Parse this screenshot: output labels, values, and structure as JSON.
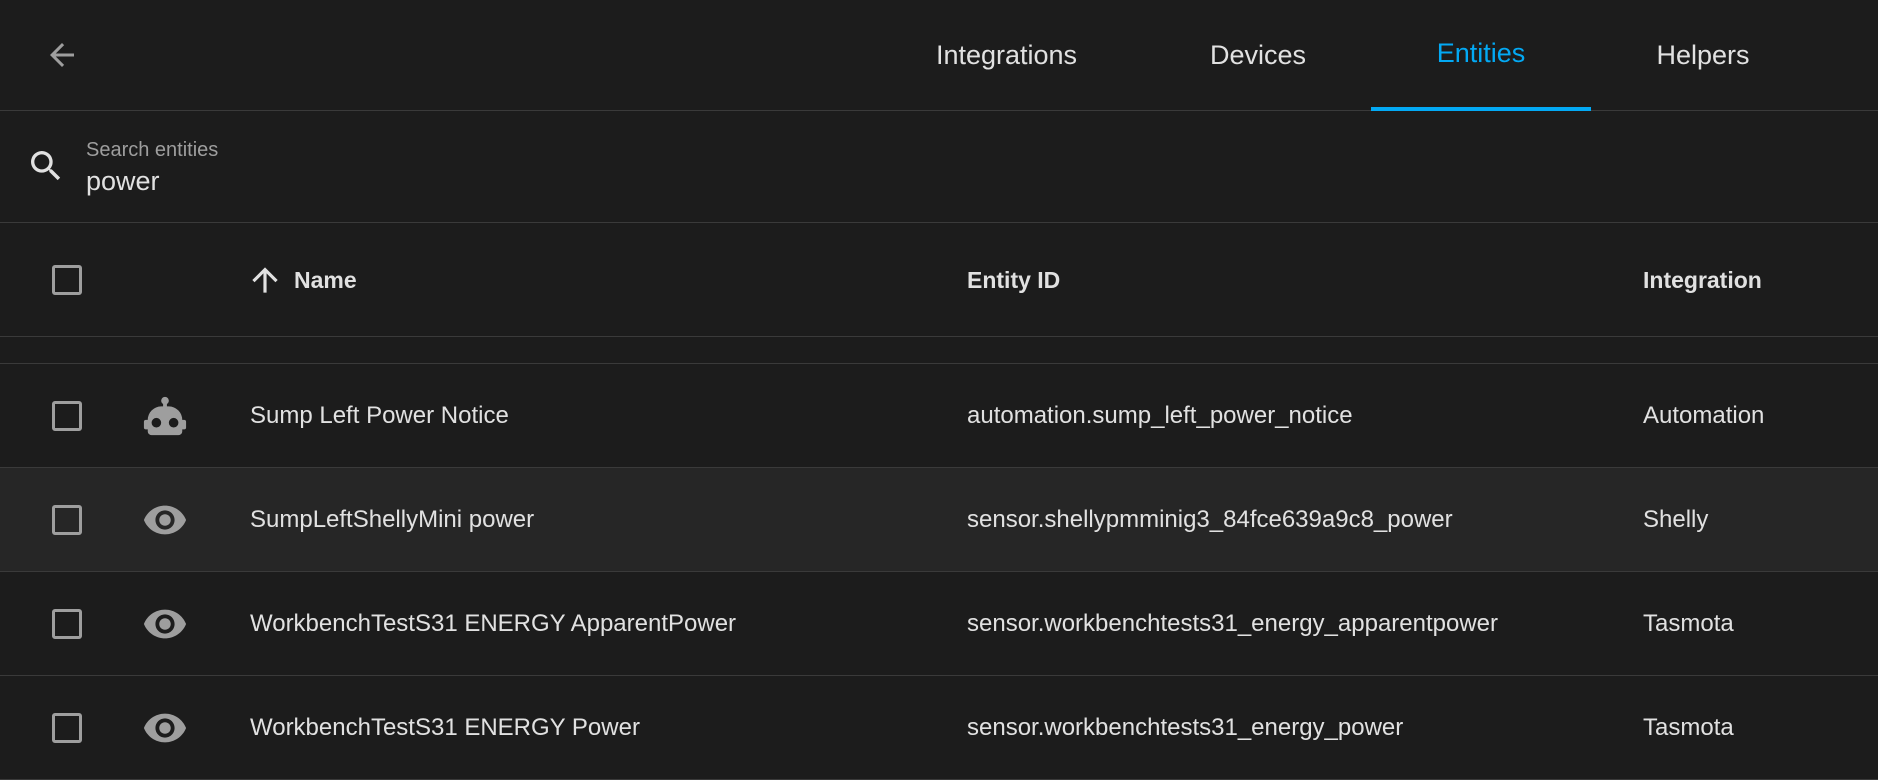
{
  "tabs": [
    {
      "label": "Integrations",
      "active": false
    },
    {
      "label": "Devices",
      "active": false
    },
    {
      "label": "Entities",
      "active": true
    },
    {
      "label": "Helpers",
      "active": false
    }
  ],
  "search": {
    "label": "Search entities",
    "value": "power"
  },
  "table": {
    "headers": {
      "name": "Name",
      "entity_id": "Entity ID",
      "integration": "Integration"
    },
    "sort_icon": "arrow-up-icon",
    "rows": [
      {
        "icon": "robot-icon",
        "name": "Sump Left Power Notice",
        "entity_id": "automation.sump_left_power_notice",
        "integration": "Automation"
      },
      {
        "icon": "eye-icon",
        "name": "SumpLeftShellyMini power",
        "entity_id": "sensor.shellypmminig3_84fce639a9c8_power",
        "integration": "Shelly"
      },
      {
        "icon": "eye-icon",
        "name": "WorkbenchTestS31 ENERGY ApparentPower",
        "entity_id": "sensor.workbenchtests31_energy_apparentpower",
        "integration": "Tasmota"
      },
      {
        "icon": "eye-icon",
        "name": "WorkbenchTestS31 ENERGY Power",
        "entity_id": "sensor.workbenchtests31_energy_power",
        "integration": "Tasmota"
      }
    ]
  },
  "colors": {
    "background": "#1c1c1c",
    "accent": "#03a9f4",
    "divider": "#3a3a3a",
    "secondary_text": "#9e9e9e"
  }
}
